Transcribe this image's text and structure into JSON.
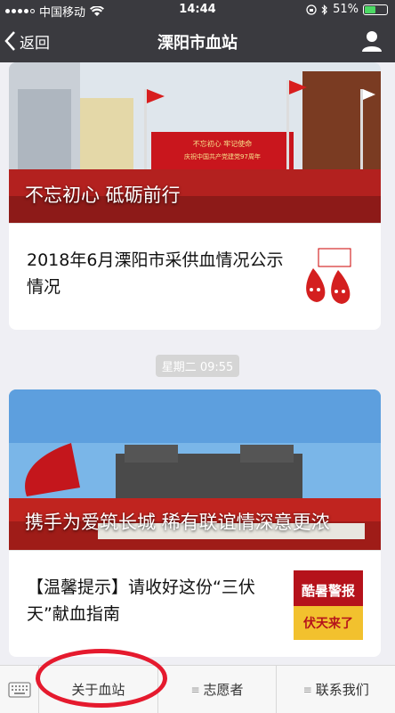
{
  "status_bar": {
    "carrier": "中国移动",
    "time": "14:44",
    "battery": "51%",
    "battery_level": 0.51
  },
  "nav": {
    "back_label": "返回",
    "title": "溧阳市血站"
  },
  "articles": [
    {
      "cover_caption": "不忘初心 砥砺前行",
      "banner_text_1": "不忘初心 牢记使命",
      "banner_text_2": "庆祝中国共产党建党97周年",
      "sub_title": "2018年6月溧阳市采供血情况公示情况"
    },
    {
      "cover_caption": "携手为爱筑长城 稀有联谊情深意更浓",
      "sub_title": "【温馨提示】请收好这份“三伏天”献血指南",
      "thumb_text_1": "酷暑警报",
      "thumb_text_2": "伏天来了"
    }
  ],
  "timestamp": "星期二 09:55",
  "bottom_menu": {
    "items": [
      "关于血站",
      "志愿者",
      "联系我们"
    ]
  },
  "colors": {
    "nav_bg": "#3a3a3f",
    "annotation": "#e51a2e"
  }
}
